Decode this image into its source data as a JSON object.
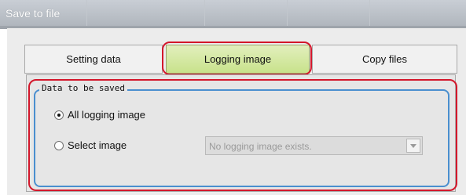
{
  "window": {
    "title": "Save to file"
  },
  "tabs": [
    {
      "label": "Setting data",
      "active": false
    },
    {
      "label": "Logging image",
      "active": true
    },
    {
      "label": "Copy files",
      "active": false
    }
  ],
  "group": {
    "legend": "Data to be saved",
    "options": [
      {
        "label": "All logging image",
        "selected": true
      },
      {
        "label": "Select image",
        "selected": false
      }
    ],
    "select": {
      "value": "No logging image exists.",
      "enabled": false,
      "icon": "chevron-down-icon"
    }
  },
  "colors": {
    "highlight": "#d3172b",
    "group_border": "#4a8fcf",
    "active_tab": "#c8e28b"
  }
}
